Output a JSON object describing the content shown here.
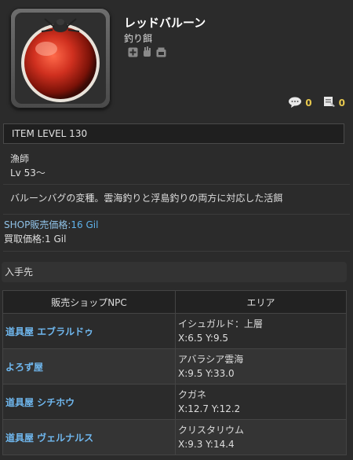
{
  "item": {
    "name": "レッドバルーン",
    "category": "釣り餌",
    "item_level": "ITEM LEVEL 130",
    "job": "漁師",
    "level": "Lv 53～",
    "description": "バルーンバグの変種。雲海釣りと浮島釣りの両方に対応した活餌",
    "badges": [
      "plus-icon",
      "hand-icon",
      "vendor-icon"
    ]
  },
  "stats": {
    "comments": "0",
    "bookmarks": "0"
  },
  "price": {
    "shop_label": "SHOP販売価格:",
    "shop_value": "16 Gil",
    "buy_label": "買取価格:",
    "buy_value": "1 Gil"
  },
  "acquisition": {
    "title": "入手先",
    "columns": [
      "販売ショップNPC",
      "エリア"
    ],
    "rows": [
      {
        "npc": "道具屋 エブラルドゥ",
        "area": "イシュガルド：上層",
        "coords": "X:6.5 Y:9.5"
      },
      {
        "npc": "よろず屋",
        "area": "アバラシア雲海",
        "coords": "X:9.5 Y:33.0"
      },
      {
        "npc": "道具屋 シチホウ",
        "area": "クガネ",
        "coords": "X:12.7 Y:12.2"
      },
      {
        "npc": "道具屋 ヴェルナルス",
        "area": "クリスタリウム",
        "coords": "X:9.3 Y:14.4"
      }
    ]
  },
  "colors": {
    "accent": "#e7c84e",
    "link": "#6fb7ee",
    "background": "#2b2b2b"
  }
}
